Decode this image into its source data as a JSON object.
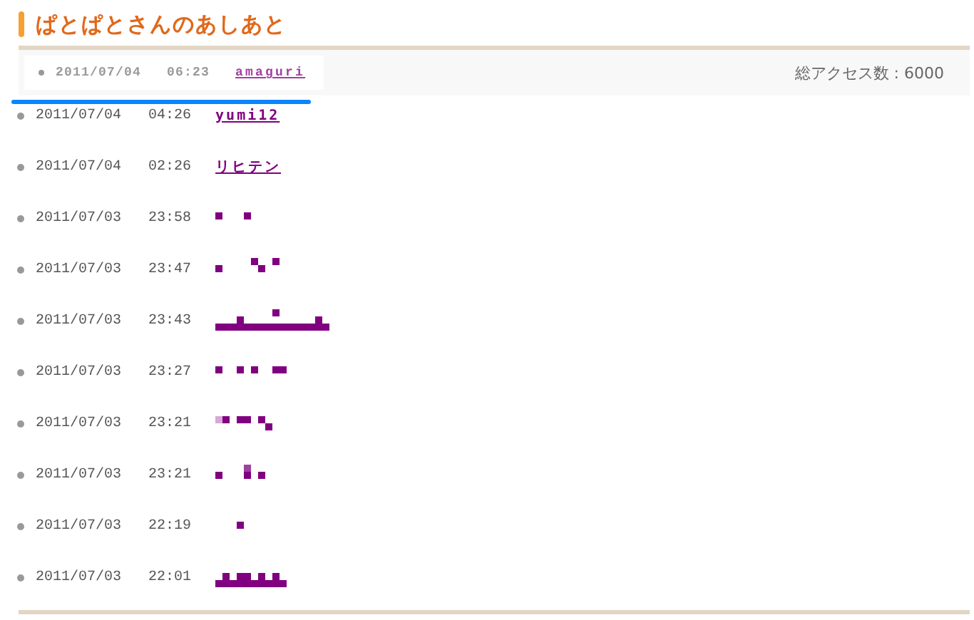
{
  "title": "ぱとぱとさんのあしあと",
  "latest": {
    "date": "2011/07/04",
    "time": "06:23",
    "name": "amaguri"
  },
  "total_access": "総アクセス数 : 6000",
  "entries": [
    {
      "kind": "link",
      "date": "2011/07/04",
      "time": "04:26",
      "name": "yumi12"
    },
    {
      "kind": "link",
      "date": "2011/07/04",
      "time": "02:26",
      "name": "リヒテン"
    },
    {
      "kind": "pixels",
      "date": "2011/07/03",
      "time": "23:58"
    },
    {
      "kind": "pixels",
      "date": "2011/07/03",
      "time": "23:47"
    },
    {
      "kind": "pixels",
      "date": "2011/07/03",
      "time": "23:43"
    },
    {
      "kind": "pixels",
      "date": "2011/07/03",
      "time": "23:27"
    },
    {
      "kind": "pixels",
      "date": "2011/07/03",
      "time": "23:21"
    },
    {
      "kind": "pixels",
      "date": "2011/07/03",
      "time": "23:21"
    },
    {
      "kind": "pixels",
      "date": "2011/07/03",
      "time": "22:19"
    },
    {
      "kind": "pixels",
      "date": "2011/07/03",
      "time": "22:01"
    }
  ]
}
